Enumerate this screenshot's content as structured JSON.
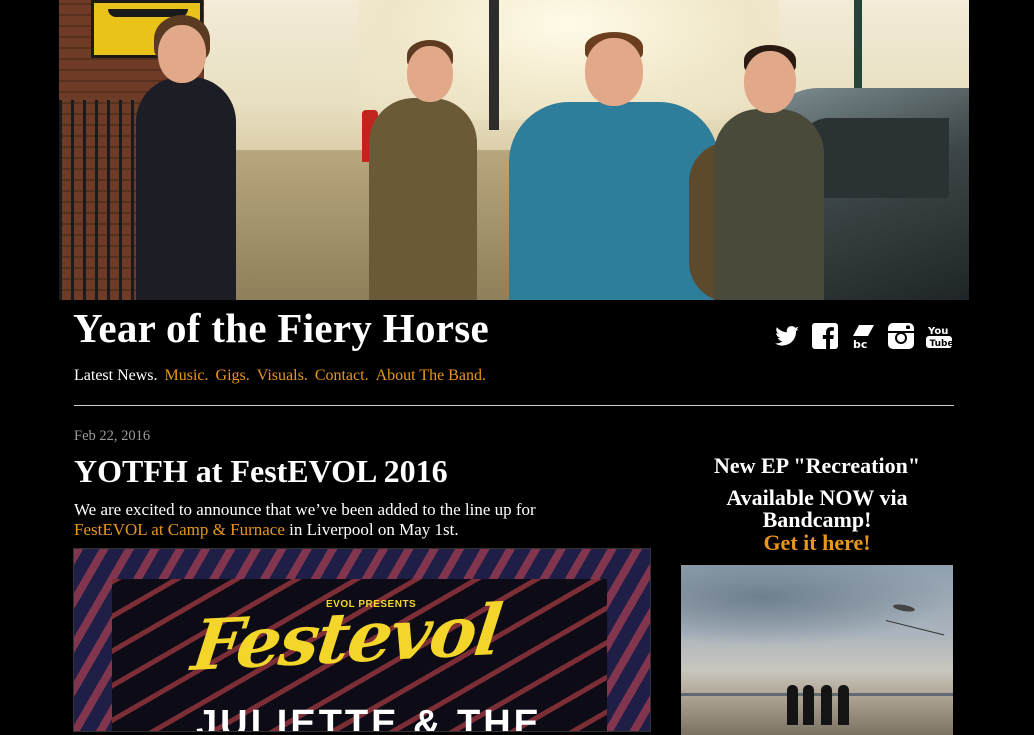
{
  "site": {
    "title": "Year of the Fiery Horse"
  },
  "hero": {
    "alt": "hero-photo"
  },
  "social": [
    {
      "name": "twitter-icon"
    },
    {
      "name": "facebook-icon"
    },
    {
      "name": "bandcamp-icon"
    },
    {
      "name": "instagram-icon"
    },
    {
      "name": "youtube-icon"
    }
  ],
  "nav": {
    "items": [
      {
        "label": "Latest News.",
        "active": true
      },
      {
        "label": "Music."
      },
      {
        "label": "Gigs."
      },
      {
        "label": "Visuals."
      },
      {
        "label": "Contact."
      },
      {
        "label": "About The Band."
      }
    ]
  },
  "post": {
    "date": "Feb 22, 2016",
    "title": "YOTFH at FestEVOL 2016",
    "body_before": "We are excited to announce that we’ve been added to the line up for",
    "link_text": "FestEVOL at Camp & Furnace",
    "body_after": " in Liverpool on May 1st.",
    "poster": {
      "presents": "EVOL PRESENTS",
      "festival": "Festevol",
      "headliner": "JULIETTE & THE"
    }
  },
  "sidebar": {
    "heading": "New EP \"Recreation\"",
    "availability": "Available NOW via Bandcamp!",
    "cta": "Get it here!"
  },
  "colors": {
    "background": "#000000",
    "accent": "#e8961c",
    "text": "#ffffff",
    "muted": "#9b9b9b"
  }
}
